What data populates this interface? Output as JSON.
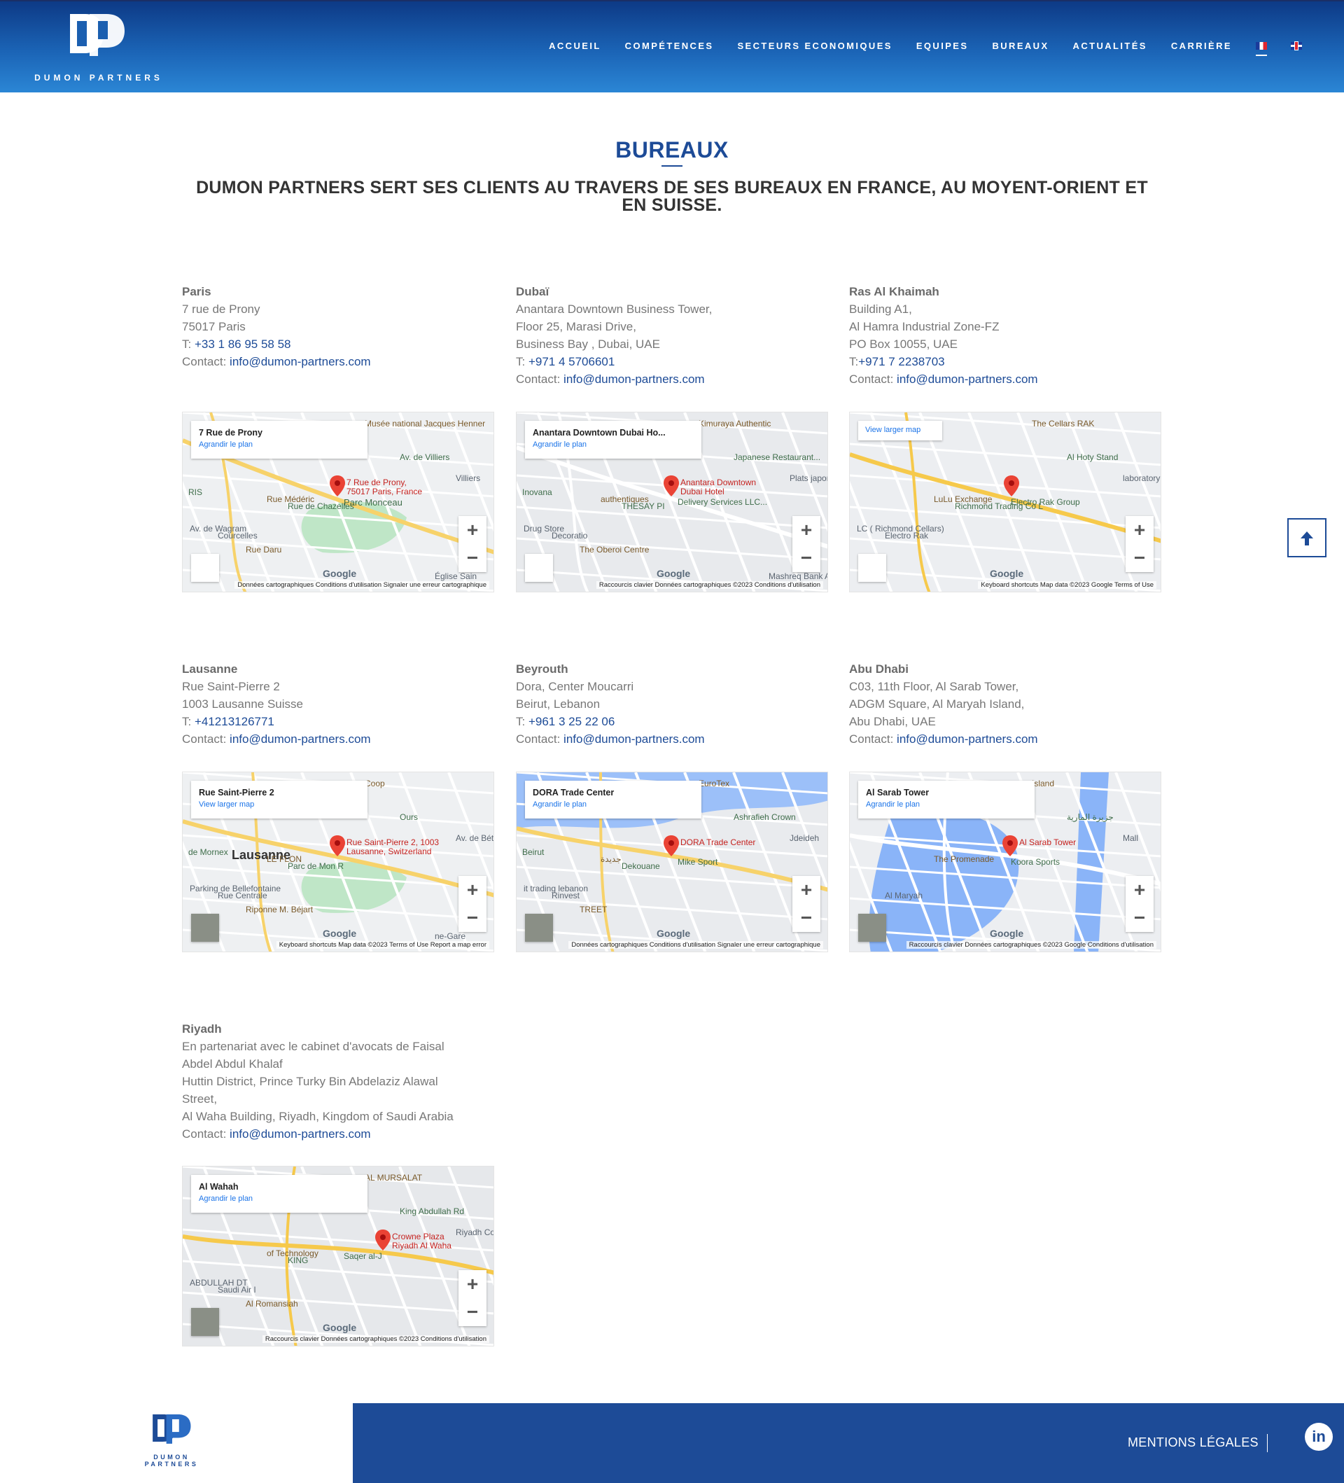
{
  "header": {
    "logo_text": "DUMON PARTNERS",
    "nav": [
      "ACCUEIL",
      "COMPÉTENCES",
      "SECTEURS ECONOMIQUES",
      "EQUIPES",
      "BUREAUX",
      "ACTUALITÉS",
      "CARRIÈRE"
    ],
    "languages": [
      "fr-flag-icon",
      "uk-flag-icon"
    ]
  },
  "title": "BUREAUX",
  "subtitle": "DUMON PARTNERS SERT SES CLIENTS AU TRAVERS DE SES BUREAUX EN FRANCE, AU MOYENT-ORIENT ET EN SUISSE.",
  "offices": [
    {
      "name": "Paris",
      "lines": [
        "7 rue de Prony",
        "75017 Paris"
      ],
      "phone_prefix": "T: ",
      "phone": "+33 1 86 95 58 58",
      "contact_prefix": "Contact: ",
      "email": "info@dumon-partners.com",
      "map": {
        "card_title": "7 Rue de Prony",
        "card_link": "Agrandir le plan",
        "pin_label_1": "7 Rue de Prony,",
        "pin_label_2": "75017 Paris, France",
        "labels": [
          "Parc Monceau",
          "Courcelles",
          "Musée national Jacques Henner",
          "Av. de Villiers",
          "Villiers",
          "Rue Médéric",
          "Rue de Chazelles",
          "Av. de Wagram",
          "Rue Daru",
          "RIS",
          "Église Sain"
        ],
        "google": "Google",
        "footer": "Données cartographiques   Conditions d'utilisation   Signaler une erreur cartographique"
      }
    },
    {
      "name": "Dubaï",
      "lines": [
        "Anantara Downtown Business Tower,",
        "Floor 25, Marasi Drive,",
        "Business Bay , Dubai, UAE"
      ],
      "phone_prefix": "T: ",
      "phone": "+971 4 5706601",
      "contact_prefix": "Contact: ",
      "email": "info@dumon-partners.com",
      "map": {
        "card_title": "Anantara Downtown Dubai Ho...",
        "card_link": "Agrandir le plan",
        "pin_label_1": "Anantara Downtown",
        "pin_label_2": "Dubai Hotel",
        "labels": [
          "Delivery Services LLC...",
          "Decoratio",
          "Kimuraya Authentic",
          "Japanese Restaurant...",
          "Plats japonais",
          "authentiques",
          "THESAY PI",
          "Drug Store",
          "The Oberoi Centre",
          "Inovana",
          "Mashreq Bank ATM"
        ],
        "google": "Google",
        "footer": "Raccourcis clavier   Données cartographiques ©2023   Conditions d'utilisation"
      }
    },
    {
      "name": "Ras Al Khaimah",
      "lines": [
        "Building A1,",
        "Al Hamra Industrial Zone-FZ",
        "PO Box 10055, UAE"
      ],
      "phone_prefix": "T:",
      "phone": "+971 7 2238703",
      "contact_prefix": "Contact: ",
      "email": "info@dumon-partners.com",
      "map": {
        "card_title": "View larger map",
        "card_link": "",
        "pin_label_1": "",
        "pin_label_2": "",
        "labels": [
          "Electro Rak Group",
          "Electro Rak",
          "The Cellars RAK",
          "Al Hoty Stand",
          "laboratory",
          "LuLu Exchange",
          "Richmond Trading Co L",
          "LC ( Richmond Cellars)"
        ],
        "google": "Google",
        "footer": "Keyboard shortcuts   Map data ©2023 Google   Terms of Use"
      }
    },
    {
      "name": "Lausanne",
      "lines": [
        "Rue Saint-Pierre 2",
        "1003 Lausanne Suisse"
      ],
      "phone_prefix": "T: ",
      "phone": "+41213126771",
      "contact_prefix": "Contact: ",
      "email": "info@dumon-partners.com",
      "map": {
        "card_title": "Rue Saint-Pierre 2",
        "card_link": "View larger map",
        "pin_label_1": "Rue Saint-Pierre 2, 1003",
        "pin_label_2": "Lausanne, Switzerland",
        "labels": [
          "Lausanne",
          "Rue Centrale",
          "Coop",
          "Ours",
          "Av. de Béthusy",
          "LE FLON",
          "Parc de Mon R",
          "Parking de Bellefontaine",
          "Riponne M. Béjart",
          "de Mornex",
          "ne-Gare"
        ],
        "google": "Google",
        "footer": "Keyboard shortcuts   Map data ©2023   Terms of Use   Report a map error"
      }
    },
    {
      "name": "Beyrouth",
      "lines": [
        "Dora, Center Moucarri",
        "Beirut, Lebanon"
      ],
      "phone_prefix": "T: ",
      "phone": "+961 3 25 22 06",
      "contact_prefix": "Contact: ",
      "email": "info@dumon-partners.com",
      "map": {
        "card_title": "DORA Trade Center",
        "card_link": "Agrandir le plan",
        "pin_label_1": "DORA Trade Center",
        "pin_label_2": "",
        "labels": [
          "Mike Sport",
          "Rinvest",
          "EuroTex",
          "Ashrafieh Crown",
          "Jdeideh",
          "جديدة",
          "Dekouane",
          "it trading lebanon",
          "TREET",
          "Beirut"
        ],
        "google": "Google",
        "footer": "Données cartographiques   Conditions d'utilisation   Signaler une erreur cartographique"
      }
    },
    {
      "name": "Abu Dhabi",
      "lines": [
        "C03, 11th Floor, Al Sarab Tower,",
        "ADGM Square, Al Maryah Island,",
        "Abu Dhabi, UAE"
      ],
      "phone_prefix": "",
      "phone": "",
      "contact_prefix": "Contact: ",
      "email": "info@dumon-partners.com",
      "map": {
        "card_title": "Al Sarab Tower",
        "card_link": "Agrandir le plan",
        "pin_label_1": "Al Sarab Tower",
        "pin_label_2": "",
        "labels": [
          "Koora Sports",
          "Al Maryah",
          "Island",
          "جزيرة المارية",
          "Mall",
          "The Promenade"
        ],
        "google": "Google",
        "footer": "Raccourcis clavier   Données cartographiques ©2023 Google   Conditions d'utilisation"
      }
    },
    {
      "name": "Riyadh",
      "lines": [
        "En partenariat avec le cabinet d'avocats de Faisal",
        "Abdel Abdul Khalaf",
        "Huttin District, Prince Turky Bin Abdelaziz Alawal",
        "Street,",
        "Al Waha Building, Riyadh, Kingdom of Saudi Arabia"
      ],
      "phone_prefix": "",
      "phone": "",
      "contact_prefix": "Contact: ",
      "email": "info@dumon-partners.com",
      "map": {
        "card_title": "Al Wahah",
        "card_link": "Agrandir le plan",
        "pin_label_1": "Crowne Plaza",
        "pin_label_2": "Riyadh Al Waha",
        "labels": [
          "Saqer al-J",
          "Saudi Air I",
          "AL MURSALAT",
          "King Abdullah Rd",
          "Riyadh College",
          "of Technology",
          "KING",
          "ABDULLAH DT",
          "Al Romansiah"
        ],
        "google": "Google",
        "footer": "Raccourcis clavier   Données cartographiques ©2023   Conditions d'utilisation"
      }
    }
  ],
  "back_to_top": "arrow-up-icon",
  "footer": {
    "logo_text": "DUMON PARTNERS",
    "legal": "MENTIONS LÉGALES",
    "social": "in"
  },
  "colors": {
    "brand": "#1d4b97",
    "header_top": "#0d3a86",
    "header_bottom": "#2b86d5",
    "pin": "#ea4335"
  }
}
